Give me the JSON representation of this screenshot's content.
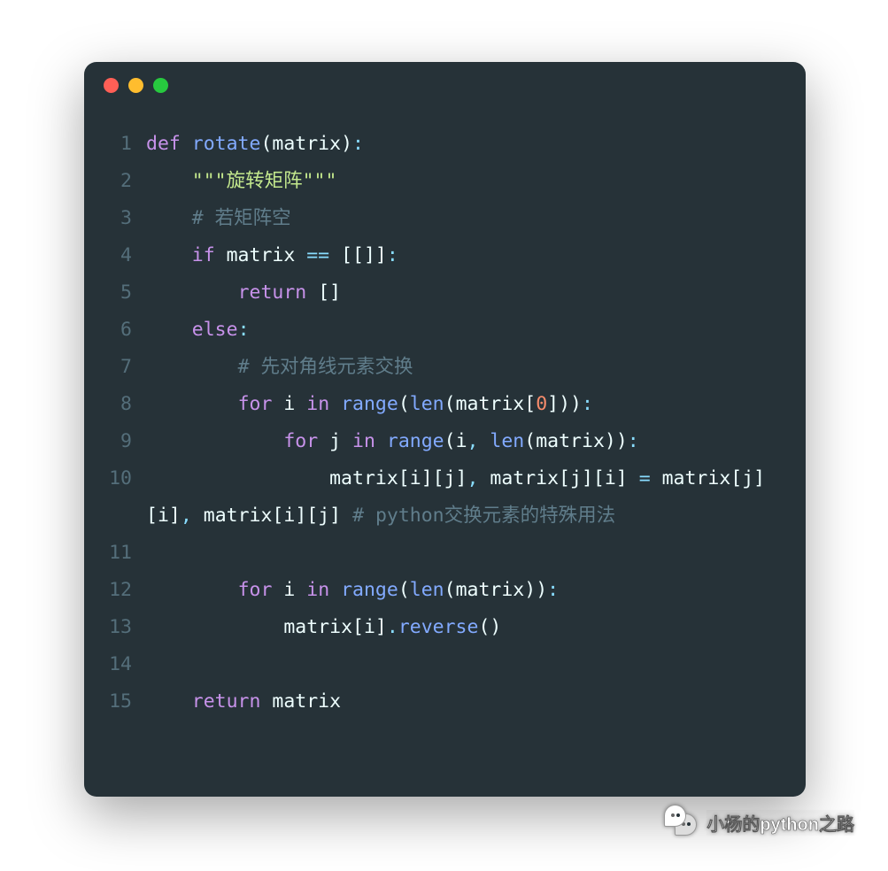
{
  "window": {
    "dots": [
      "red",
      "yellow",
      "green"
    ]
  },
  "code": {
    "lines": [
      {
        "num": "1",
        "tokens": [
          {
            "t": "def ",
            "c": "kw"
          },
          {
            "t": "rotate",
            "c": "fn"
          },
          {
            "t": "(",
            "c": "paren"
          },
          {
            "t": "matrix",
            "c": "id"
          },
          {
            "t": ")",
            "c": "paren"
          },
          {
            "t": ":",
            "c": "op"
          }
        ]
      },
      {
        "num": "2",
        "tokens": [
          {
            "t": "    ",
            "c": "id"
          },
          {
            "t": "\"\"\"旋转矩阵\"\"\"",
            "c": "str"
          }
        ]
      },
      {
        "num": "3",
        "tokens": [
          {
            "t": "    ",
            "c": "id"
          },
          {
            "t": "# 若矩阵空",
            "c": "cmt"
          }
        ]
      },
      {
        "num": "4",
        "tokens": [
          {
            "t": "    ",
            "c": "id"
          },
          {
            "t": "if",
            "c": "kw"
          },
          {
            "t": " matrix ",
            "c": "id"
          },
          {
            "t": "==",
            "c": "op"
          },
          {
            "t": " ",
            "c": "id"
          },
          {
            "t": "[[]]",
            "c": "paren"
          },
          {
            "t": ":",
            "c": "op"
          }
        ]
      },
      {
        "num": "5",
        "tokens": [
          {
            "t": "        ",
            "c": "id"
          },
          {
            "t": "return",
            "c": "kw"
          },
          {
            "t": " ",
            "c": "id"
          },
          {
            "t": "[]",
            "c": "paren"
          }
        ]
      },
      {
        "num": "6",
        "tokens": [
          {
            "t": "    ",
            "c": "id"
          },
          {
            "t": "else",
            "c": "kw"
          },
          {
            "t": ":",
            "c": "op"
          }
        ]
      },
      {
        "num": "7",
        "tokens": [
          {
            "t": "        ",
            "c": "id"
          },
          {
            "t": "# 先对角线元素交换",
            "c": "cmt"
          }
        ]
      },
      {
        "num": "8",
        "tokens": [
          {
            "t": "        ",
            "c": "id"
          },
          {
            "t": "for",
            "c": "kw"
          },
          {
            "t": " i ",
            "c": "id"
          },
          {
            "t": "in",
            "c": "kw"
          },
          {
            "t": " ",
            "c": "id"
          },
          {
            "t": "range",
            "c": "builtin"
          },
          {
            "t": "(",
            "c": "paren"
          },
          {
            "t": "len",
            "c": "builtin"
          },
          {
            "t": "(",
            "c": "paren"
          },
          {
            "t": "matrix",
            "c": "id"
          },
          {
            "t": "[",
            "c": "paren"
          },
          {
            "t": "0",
            "c": "num"
          },
          {
            "t": "]))",
            "c": "paren"
          },
          {
            "t": ":",
            "c": "op"
          }
        ]
      },
      {
        "num": "9",
        "tokens": [
          {
            "t": "            ",
            "c": "id"
          },
          {
            "t": "for",
            "c": "kw"
          },
          {
            "t": " j ",
            "c": "id"
          },
          {
            "t": "in",
            "c": "kw"
          },
          {
            "t": " ",
            "c": "id"
          },
          {
            "t": "range",
            "c": "builtin"
          },
          {
            "t": "(",
            "c": "paren"
          },
          {
            "t": "i",
            "c": "id"
          },
          {
            "t": ",",
            "c": "op"
          },
          {
            "t": " ",
            "c": "id"
          },
          {
            "t": "len",
            "c": "builtin"
          },
          {
            "t": "(",
            "c": "paren"
          },
          {
            "t": "matrix",
            "c": "id"
          },
          {
            "t": "))",
            "c": "paren"
          },
          {
            "t": ":",
            "c": "op"
          }
        ]
      },
      {
        "num": "10",
        "tokens": [
          {
            "t": "                matrix",
            "c": "id"
          },
          {
            "t": "[",
            "c": "paren"
          },
          {
            "t": "i",
            "c": "id"
          },
          {
            "t": "][",
            "c": "paren"
          },
          {
            "t": "j",
            "c": "id"
          },
          {
            "t": "]",
            "c": "paren"
          },
          {
            "t": ",",
            "c": "op"
          },
          {
            "t": " matrix",
            "c": "id"
          },
          {
            "t": "[",
            "c": "paren"
          },
          {
            "t": "j",
            "c": "id"
          },
          {
            "t": "][",
            "c": "paren"
          },
          {
            "t": "i",
            "c": "id"
          },
          {
            "t": "]",
            "c": "paren"
          },
          {
            "t": " = ",
            "c": "op"
          },
          {
            "t": "matrix",
            "c": "id"
          },
          {
            "t": "[",
            "c": "paren"
          },
          {
            "t": "j",
            "c": "id"
          },
          {
            "t": "][",
            "c": "paren"
          },
          {
            "t": "i",
            "c": "id"
          },
          {
            "t": "]",
            "c": "paren"
          },
          {
            "t": ",",
            "c": "op"
          },
          {
            "t": " matrix",
            "c": "id"
          },
          {
            "t": "[",
            "c": "paren"
          },
          {
            "t": "i",
            "c": "id"
          },
          {
            "t": "][",
            "c": "paren"
          },
          {
            "t": "j",
            "c": "id"
          },
          {
            "t": "]",
            "c": "paren"
          },
          {
            "t": " ",
            "c": "id"
          },
          {
            "t": "# python交换元素的特殊用法",
            "c": "cmt"
          }
        ]
      },
      {
        "num": "11",
        "tokens": []
      },
      {
        "num": "12",
        "tokens": [
          {
            "t": "        ",
            "c": "id"
          },
          {
            "t": "for",
            "c": "kw"
          },
          {
            "t": " i ",
            "c": "id"
          },
          {
            "t": "in",
            "c": "kw"
          },
          {
            "t": " ",
            "c": "id"
          },
          {
            "t": "range",
            "c": "builtin"
          },
          {
            "t": "(",
            "c": "paren"
          },
          {
            "t": "len",
            "c": "builtin"
          },
          {
            "t": "(",
            "c": "paren"
          },
          {
            "t": "matrix",
            "c": "id"
          },
          {
            "t": "))",
            "c": "paren"
          },
          {
            "t": ":",
            "c": "op"
          }
        ]
      },
      {
        "num": "13",
        "tokens": [
          {
            "t": "            matrix",
            "c": "id"
          },
          {
            "t": "[",
            "c": "paren"
          },
          {
            "t": "i",
            "c": "id"
          },
          {
            "t": "]",
            "c": "paren"
          },
          {
            "t": ".",
            "c": "op"
          },
          {
            "t": "reverse",
            "c": "builtin"
          },
          {
            "t": "()",
            "c": "paren"
          }
        ]
      },
      {
        "num": "14",
        "tokens": []
      },
      {
        "num": "15",
        "tokens": [
          {
            "t": "    ",
            "c": "id"
          },
          {
            "t": "return",
            "c": "kw"
          },
          {
            "t": " matrix",
            "c": "id"
          }
        ]
      }
    ]
  },
  "watermark": {
    "text": "小杨的python之路"
  }
}
